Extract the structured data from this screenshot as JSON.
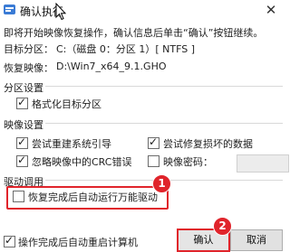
{
  "window": {
    "title": "确认执行",
    "close_glyph": "✕",
    "icon": "app-icon"
  },
  "intro": "即将开始映像恢复操作，确认信息后单击“确认”按钮继续。",
  "info": {
    "target_label": "目标分区：",
    "target_value": "C:（磁盘 0：分区 1）[ NTFS ]",
    "image_label": "恢复映像：",
    "image_value": "D:\\Win7_x64_9.1.GHO"
  },
  "partition_settings": {
    "title": "分区设置",
    "format_label": "格式化目标分区",
    "format_checked": true
  },
  "image_settings": {
    "title": "映像设置",
    "rebuild_boot_label": "尝试重建系统引导",
    "rebuild_boot_checked": true,
    "repair_data_label": "尝试修复损坏的数据",
    "repair_data_checked": true,
    "ignore_crc_label": "忽略映像中的CRC错误",
    "ignore_crc_checked": true,
    "image_password_label": "映像密码：",
    "image_password_checked": false,
    "image_password_value": ""
  },
  "driver_settings": {
    "title": "驱动调用",
    "auto_driver_label": "恢复完成后自动运行万能驱动",
    "auto_driver_checked": false
  },
  "footer": {
    "reboot_label": "操作完成后自动重启计算机",
    "reboot_checked": true,
    "confirm_label": "确认",
    "cancel_label": "取消"
  },
  "annotations": {
    "badge_1": "1",
    "badge_2": "2",
    "accent_color": "#e0242b"
  },
  "check_glyph": "✓"
}
